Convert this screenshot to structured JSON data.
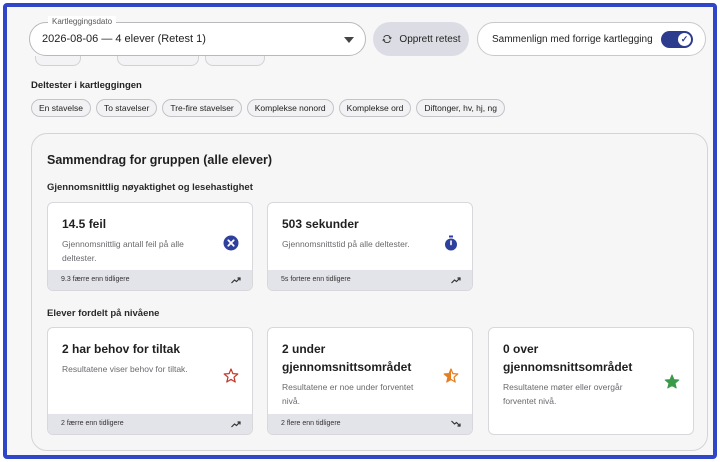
{
  "date_field": {
    "legend": "Kartleggingsdato",
    "value": "2026-08-06 — 4 elever (Retest 1)"
  },
  "retest_button": {
    "label": "Opprett retest"
  },
  "compare_toggle": {
    "label": "Sammenlign med forrige kartlegging",
    "checked": true
  },
  "subtests": {
    "title": "Deltester i kartleggingen",
    "items": [
      "En stavelse",
      "To stavelser",
      "Tre-fire stavelser",
      "Komplekse nonord",
      "Komplekse ord",
      "Diftonger, hv, hj, ng"
    ]
  },
  "summary": {
    "title": "Sammendrag for gruppen (alle elever)",
    "accuracy_title": "Gjennomsnittlig nøyaktighet og lesehastighet",
    "accuracy_cards": [
      {
        "value": "14.5 feil",
        "desc": "Gjennomsnittlig antall feil på alle deltester.",
        "footer": "9.3 færre enn tidligere",
        "icon": "x-circle-icon",
        "trend": "up"
      },
      {
        "value": "503 sekunder",
        "desc": "Gjennomsnittstid på alle deltester.",
        "footer": "5s fortere enn tidligere",
        "icon": "stopwatch-icon",
        "trend": "up"
      }
    ],
    "levels_title": "Elever fordelt på nivåene",
    "level_cards": [
      {
        "value": "2 har behov for tiltak",
        "desc": "Resultatene viser behov for tiltak.",
        "footer": "2 færre enn tidligere",
        "icon": "star-outline-icon",
        "trend": "up"
      },
      {
        "value": "2 under gjennomsnittsområdet",
        "desc": "Resultatene er noe under forventet nivå.",
        "footer": "2 flere enn tidligere",
        "icon": "star-half-icon",
        "trend": "down"
      },
      {
        "value": "0 over gjennomsnittsområdet",
        "desc": "Resultatene møter eller overgår forventet nivå.",
        "footer": "",
        "icon": "star-filled-icon",
        "trend": "none"
      }
    ]
  },
  "colors": {
    "frame": "#2f46c8",
    "toggle": "#2d3b8f",
    "error_icon": "#2e3f9e",
    "star_red": "#c0392b",
    "star_orange": "#e67e22",
    "star_green": "#3a9a4a"
  }
}
